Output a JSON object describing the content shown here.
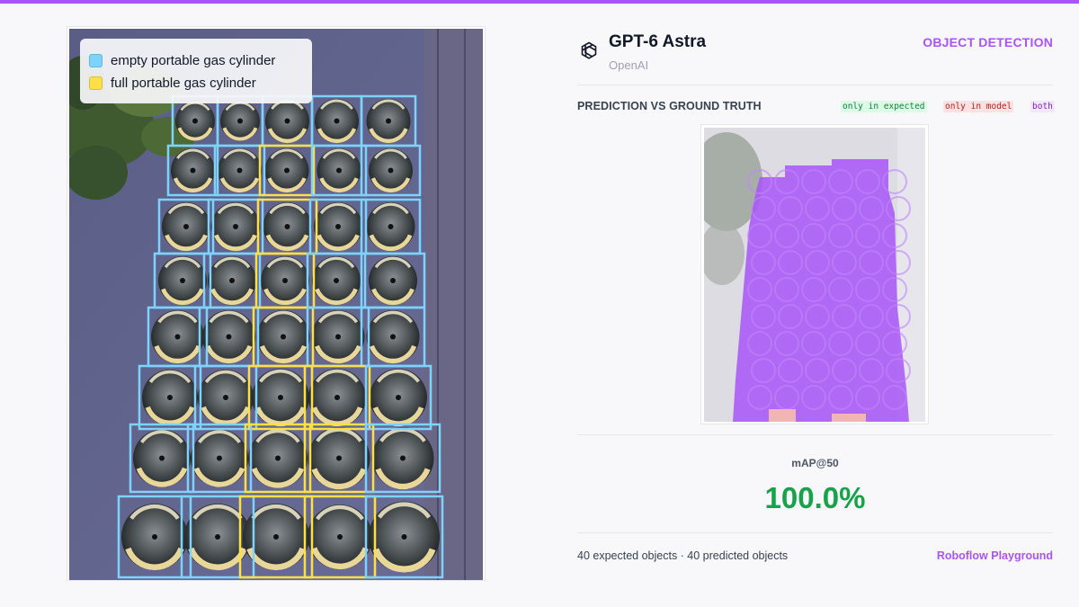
{
  "accent_color": "#a855f7",
  "legend": {
    "items": [
      {
        "label": "empty portable gas cylinder",
        "color": "#7dd3fc"
      },
      {
        "label": "full portable gas cylinder",
        "color": "#fde047"
      }
    ]
  },
  "header": {
    "model_name": "GPT-6 Astra",
    "vendor": "OpenAI",
    "task": "OBJECT DETECTION",
    "logo_icon": "openai-logo-icon"
  },
  "comparison": {
    "title": "PREDICTION VS GROUND TRUTH",
    "tags": {
      "expected": "only in expected",
      "model": "only in model",
      "both": "both"
    }
  },
  "metric": {
    "label": "mAP@50",
    "value": "100.0%"
  },
  "footer": {
    "counts": "40 expected objects · 40 predicted objects",
    "link": "Roboflow Playground"
  }
}
